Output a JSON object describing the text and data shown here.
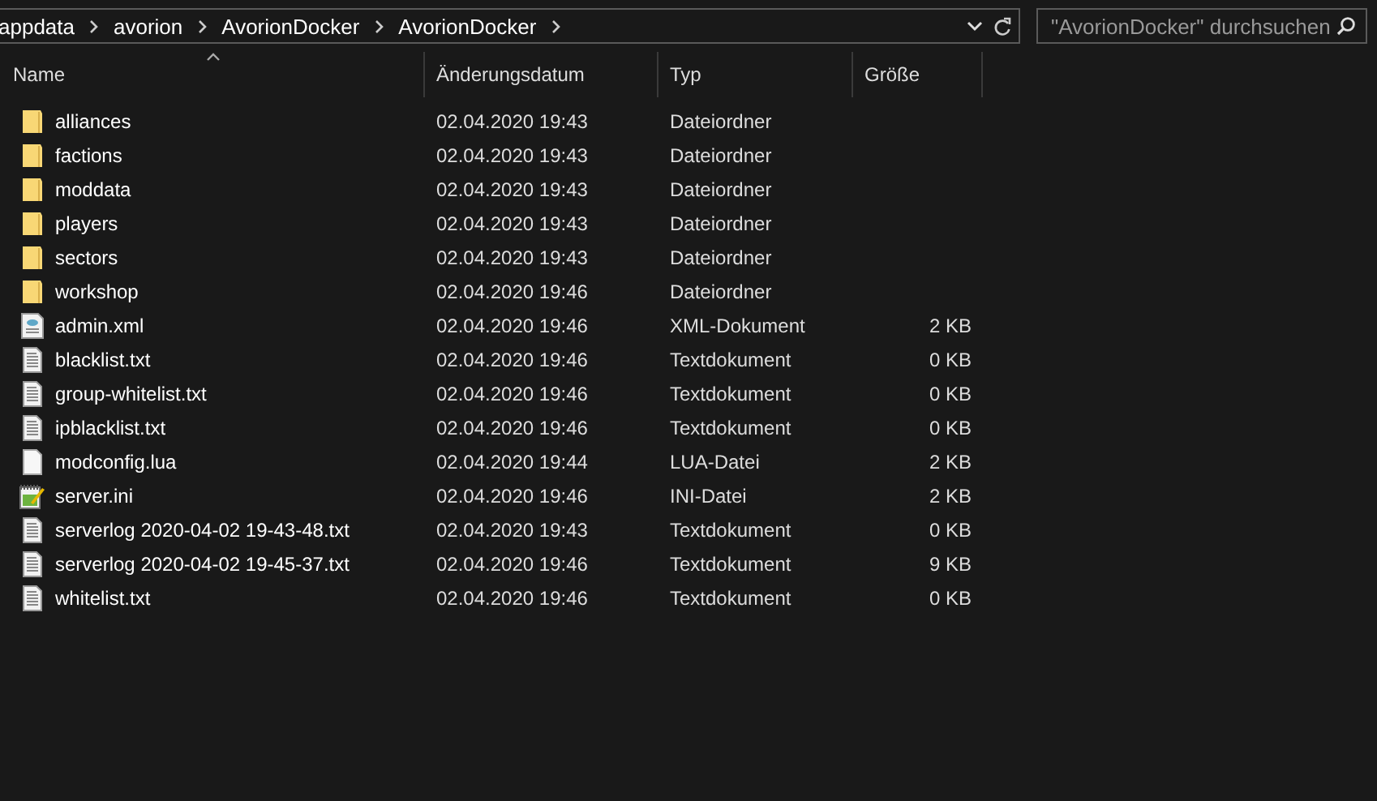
{
  "address_bar": {
    "crumbs": [
      "appdata",
      "avorion",
      "AvorionDocker",
      "AvorionDocker"
    ]
  },
  "search": {
    "placeholder": "\"AvorionDocker\" durchsuchen"
  },
  "columns": [
    "Name",
    "Änderungsdatum",
    "Typ",
    "Größe"
  ],
  "files": [
    {
      "name": "alliances",
      "date": "02.04.2020 19:43",
      "type": "Dateiordner",
      "kind": "folder"
    },
    {
      "name": "factions",
      "date": "02.04.2020 19:43",
      "type": "Dateiordner",
      "kind": "folder"
    },
    {
      "name": "moddata",
      "date": "02.04.2020 19:43",
      "type": "Dateiordner",
      "kind": "folder"
    },
    {
      "name": "players",
      "date": "02.04.2020 19:43",
      "type": "Dateiordner",
      "kind": "folder"
    },
    {
      "name": "sectors",
      "date": "02.04.2020 19:43",
      "type": "Dateiordner",
      "kind": "folder"
    },
    {
      "name": "workshop",
      "date": "02.04.2020 19:46",
      "type": "Dateiordner",
      "kind": "folder"
    },
    {
      "name": "admin.xml",
      "date": "02.04.2020 19:46",
      "type": "XML-Dokument",
      "size": "2 KB",
      "kind": "xml"
    },
    {
      "name": "blacklist.txt",
      "date": "02.04.2020 19:46",
      "type": "Textdokument",
      "size": "0 KB",
      "kind": "text"
    },
    {
      "name": "group-whitelist.txt",
      "date": "02.04.2020 19:46",
      "type": "Textdokument",
      "size": "0 KB",
      "kind": "text"
    },
    {
      "name": "ipblacklist.txt",
      "date": "02.04.2020 19:46",
      "type": "Textdokument",
      "size": "0 KB",
      "kind": "text"
    },
    {
      "name": "modconfig.lua",
      "date": "02.04.2020 19:44",
      "type": "LUA-Datei",
      "size": "2 KB",
      "kind": "blank"
    },
    {
      "name": "server.ini",
      "date": "02.04.2020 19:46",
      "type": "INI-Datei",
      "size": "2 KB",
      "kind": "ini"
    },
    {
      "name": "serverlog 2020-04-02 19-43-48.txt",
      "date": "02.04.2020 19:43",
      "type": "Textdokument",
      "size": "0 KB",
      "kind": "text"
    },
    {
      "name": "serverlog 2020-04-02 19-45-37.txt",
      "date": "02.04.2020 19:46",
      "type": "Textdokument",
      "size": "9 KB",
      "kind": "text"
    },
    {
      "name": "whitelist.txt",
      "date": "02.04.2020 19:46",
      "type": "Textdokument",
      "size": "0 KB",
      "kind": "text"
    }
  ]
}
